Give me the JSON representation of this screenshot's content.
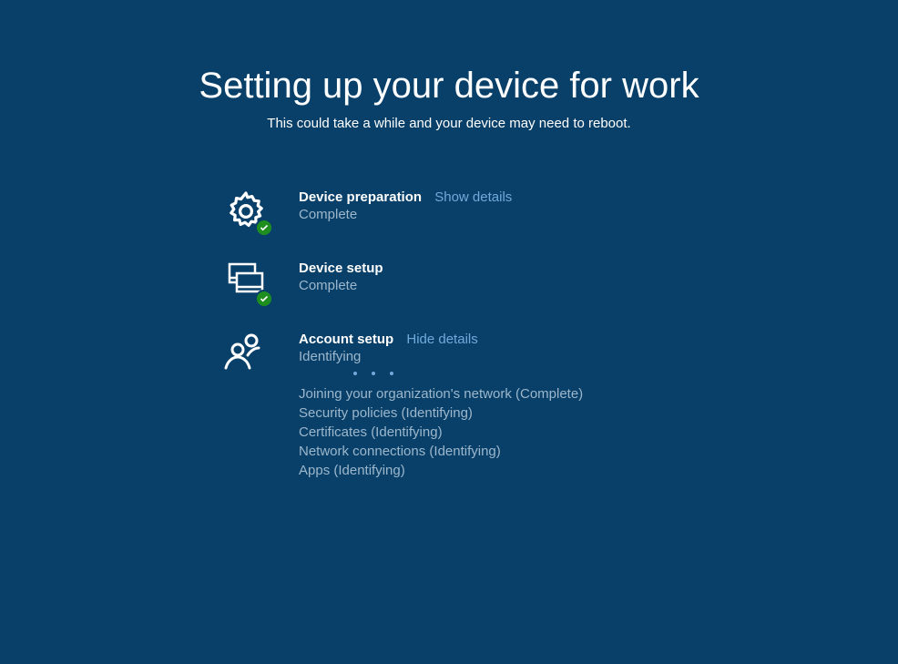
{
  "title": "Setting up your device for work",
  "subtitle": "This could take a while and your device may need to reboot.",
  "sections": {
    "device_prep": {
      "label": "Device preparation",
      "link": "Show details",
      "status": "Complete"
    },
    "device_setup": {
      "label": "Device setup",
      "status": "Complete"
    },
    "account_setup": {
      "label": "Account setup",
      "link": "Hide details",
      "status": "Identifying",
      "details": [
        "Joining your organization's network (Complete)",
        "Security policies (Identifying)",
        "Certificates (Identifying)",
        "Network connections (Identifying)",
        "Apps (Identifying)"
      ]
    }
  }
}
